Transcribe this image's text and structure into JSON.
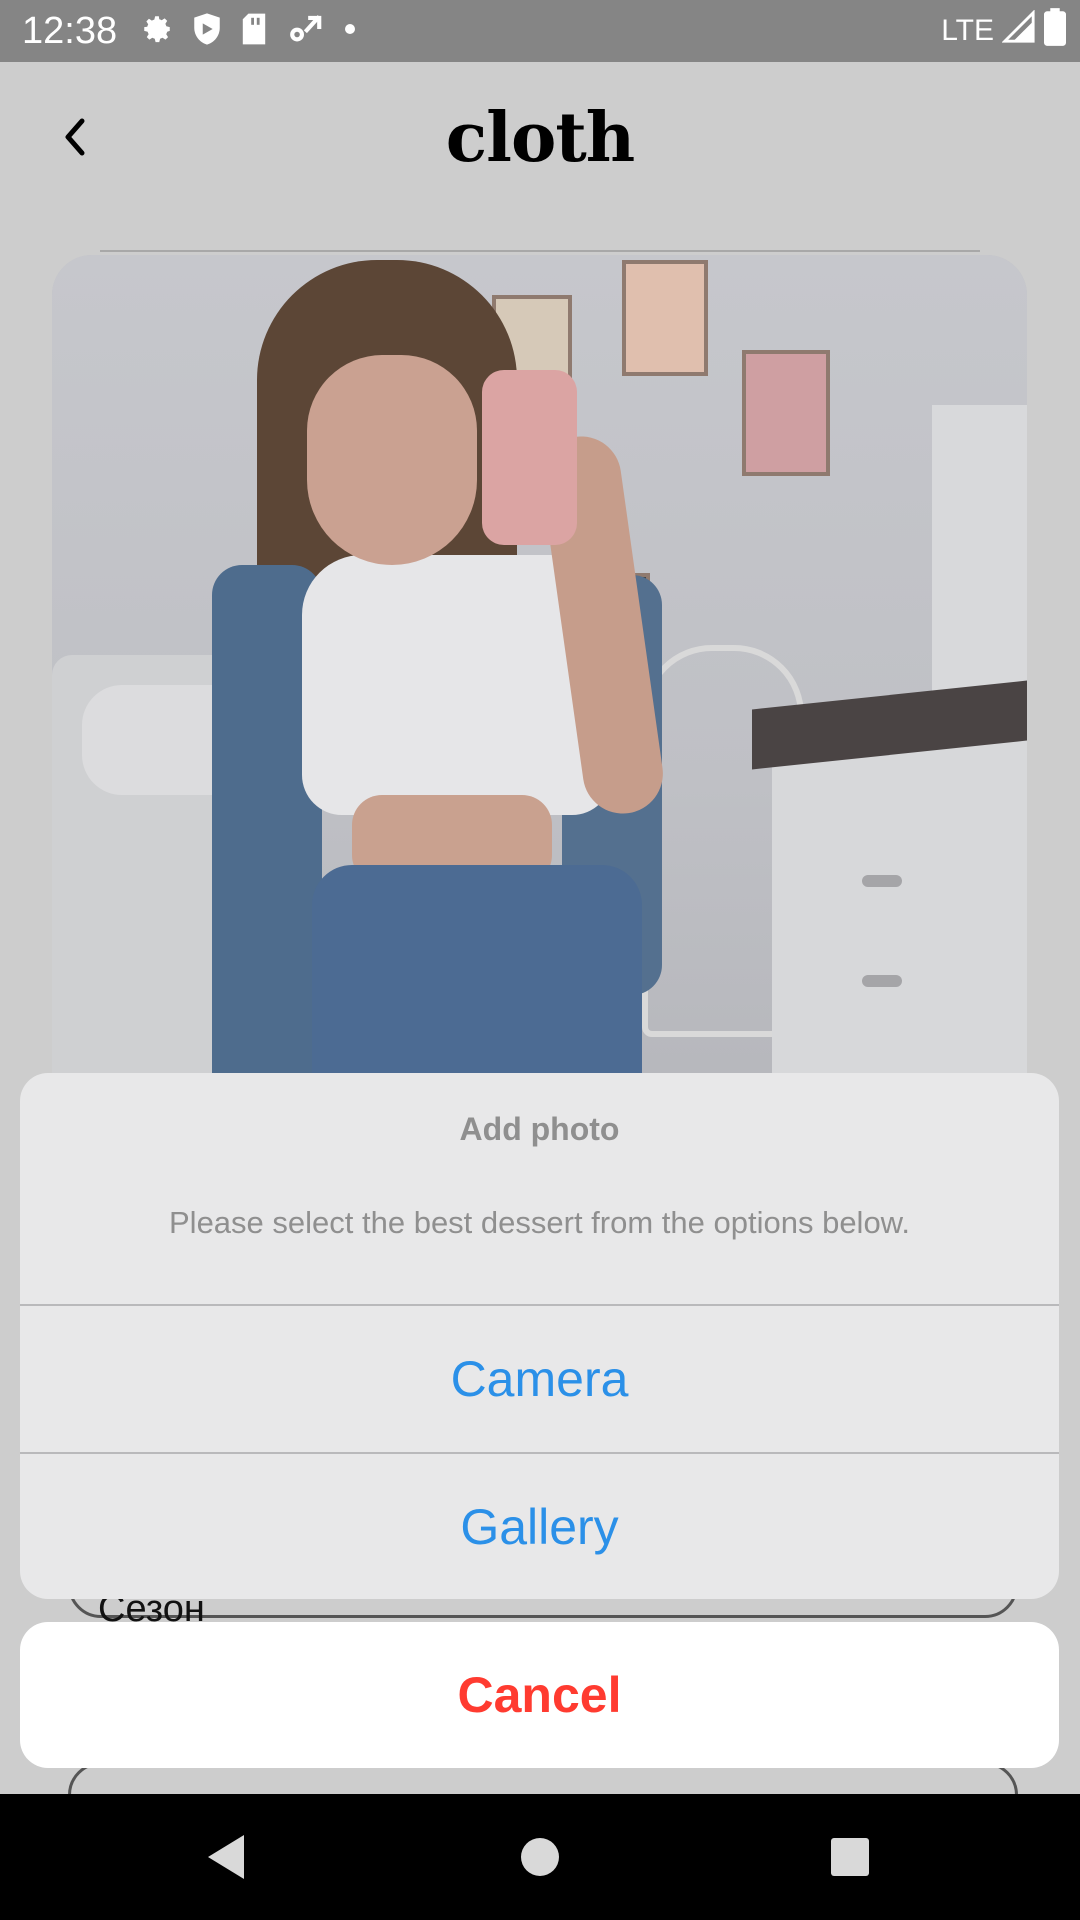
{
  "status_bar": {
    "time": "12:38",
    "network": "LTE",
    "icons": [
      "settings-icon",
      "shield-icon",
      "sd-card-icon",
      "network-settings-icon",
      "dot-icon",
      "signal-icon",
      "battery-icon"
    ]
  },
  "header": {
    "title": "cloth",
    "back_icon": "chevron-left-icon"
  },
  "form": {
    "season_label": "Сезон"
  },
  "action_sheet": {
    "title": "Add photo",
    "message": "Please select the best dessert from the options below.",
    "actions": [
      {
        "label": "Camera"
      },
      {
        "label": "Gallery"
      }
    ],
    "cancel_label": "Cancel"
  },
  "colors": {
    "action": "#2b90e8",
    "destructive": "#ff3b30",
    "status_bar": "#858585"
  },
  "nav_bar": {
    "icons": [
      "back-triangle-icon",
      "home-circle-icon",
      "recents-square-icon"
    ]
  }
}
